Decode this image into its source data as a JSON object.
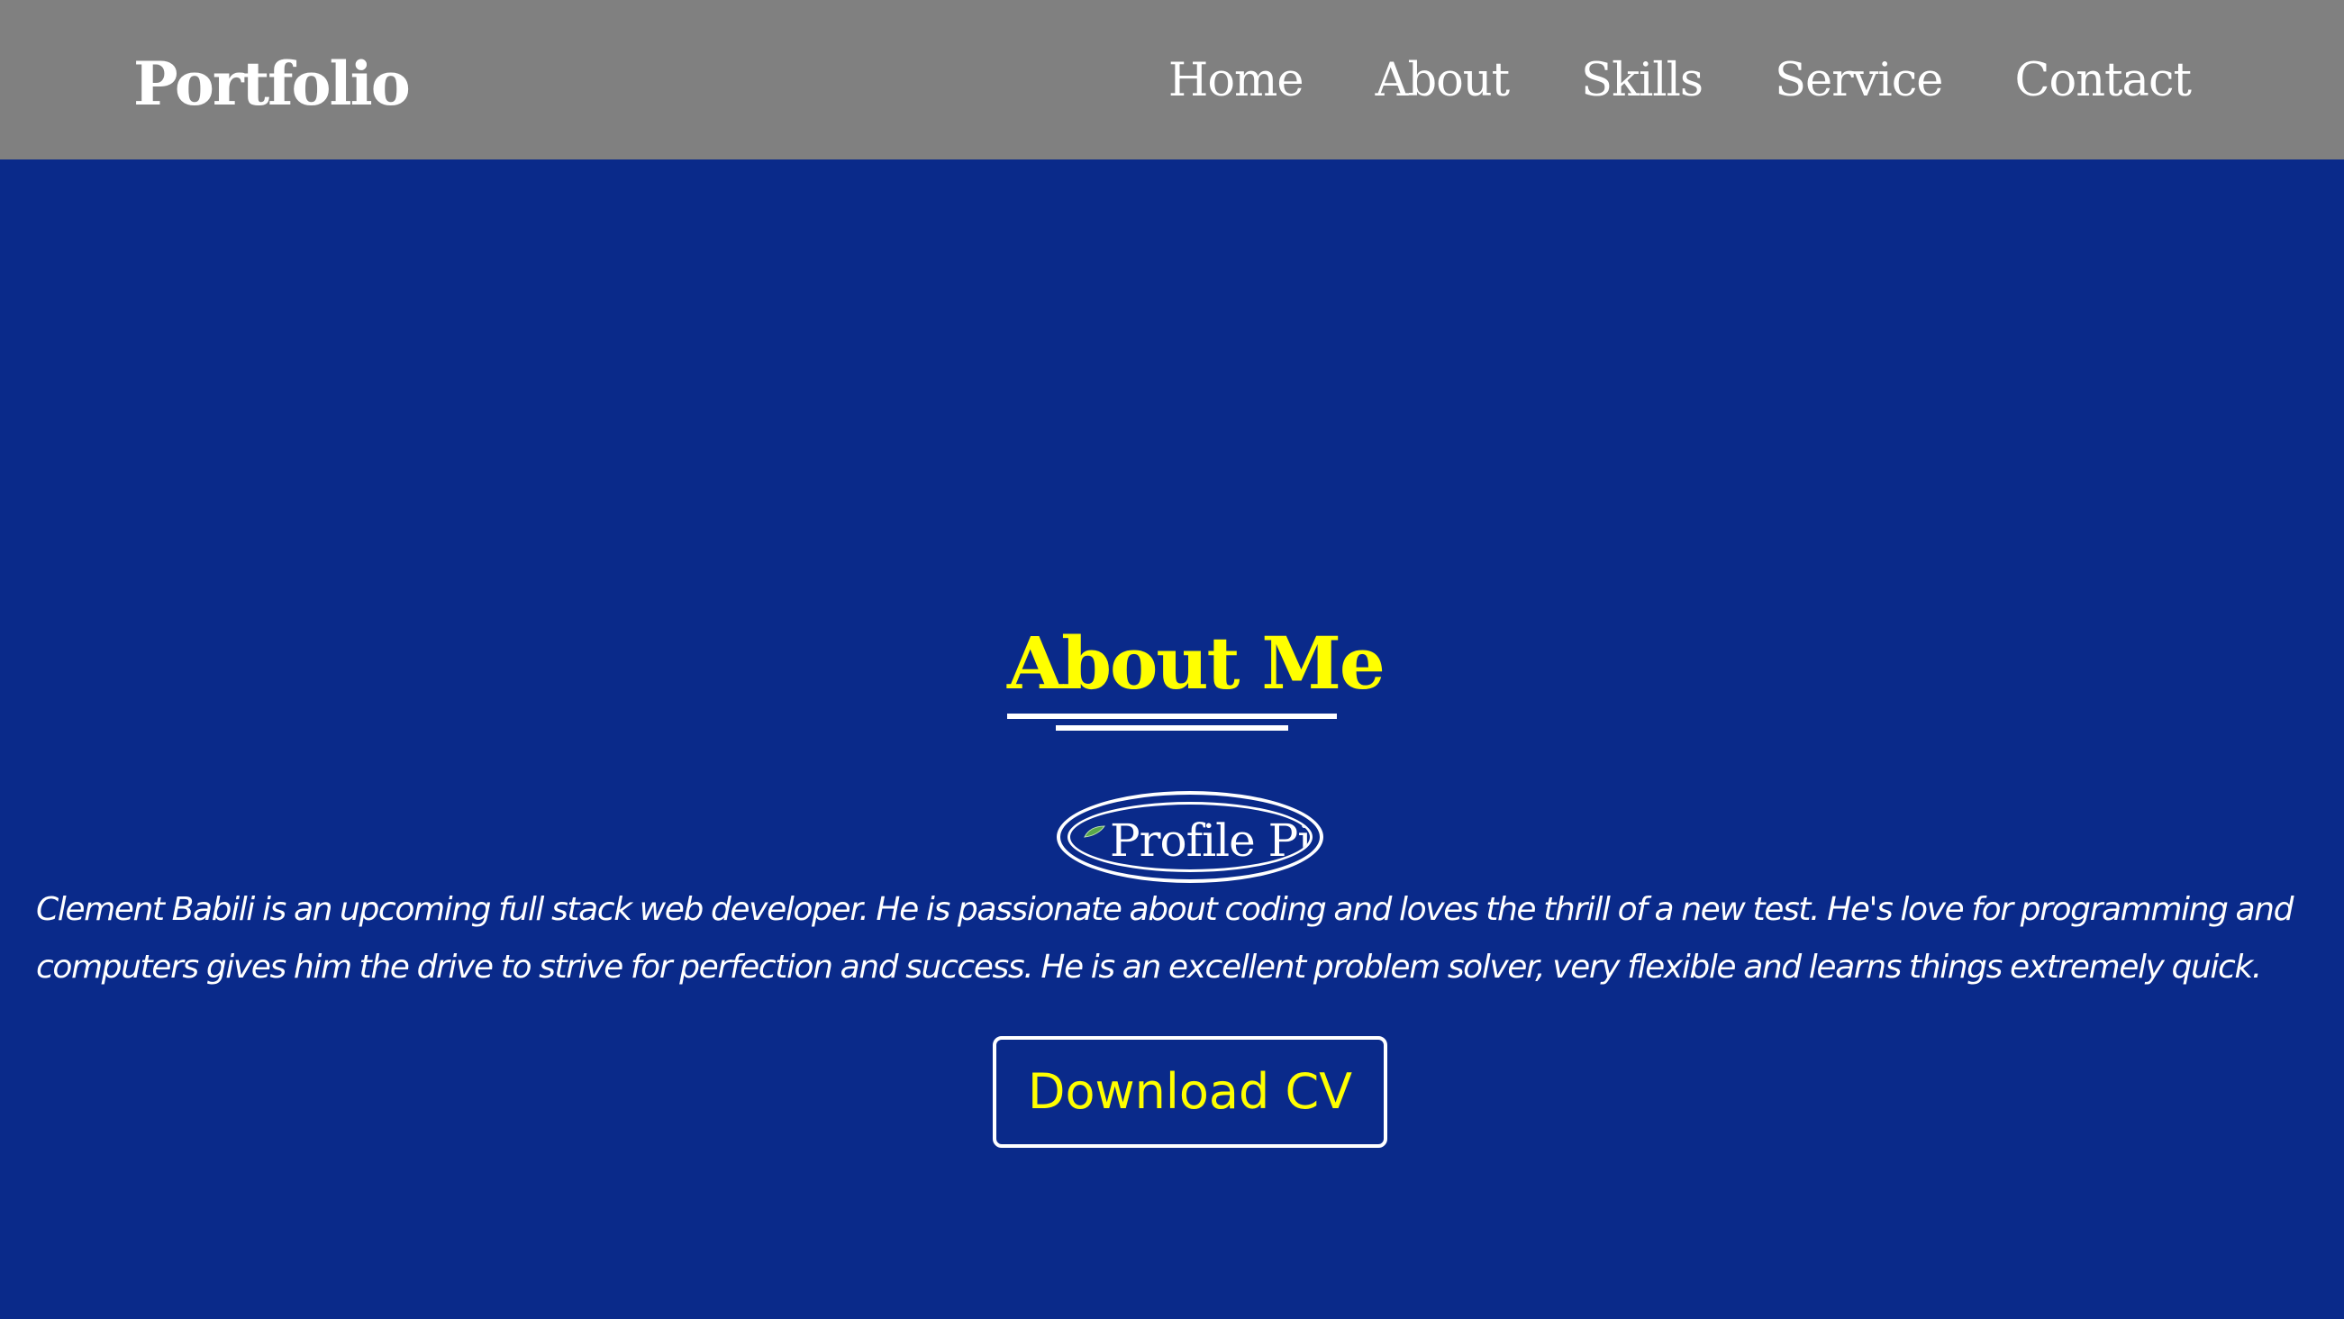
{
  "header": {
    "logo": "Portfolio",
    "nav": [
      {
        "label": "Home"
      },
      {
        "label": "About"
      },
      {
        "label": "Skills"
      },
      {
        "label": "Service"
      },
      {
        "label": "Contact"
      }
    ]
  },
  "about": {
    "title": "About Me",
    "profile_pic_alt": "Profile Pic",
    "bio": "Clement Babili is an upcoming full stack web developer. He is passionate about coding and loves the thrill of a new test. He's love for programming and computers gives him the drive to strive for perfection and success. He is an excellent problem solver, very flexible and learns things extremely quick.",
    "cv_button": "Download CV"
  },
  "colors": {
    "nav_background": "#808080",
    "page_background": "#0a2a8a",
    "accent": "#ffff00",
    "text": "#ffffff"
  }
}
